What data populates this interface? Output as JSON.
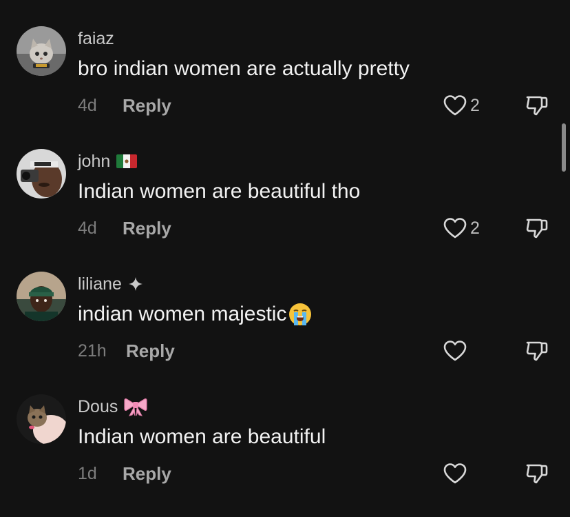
{
  "comments": [
    {
      "username": "faiaz",
      "badge": "",
      "text": "bro indian women are actually pretty",
      "time": "4d",
      "reply_label": "Reply",
      "likes": "2",
      "avatar": "cat-avatar"
    },
    {
      "username": "john",
      "badge": "mexico-flag",
      "text": "Indian women are beautiful tho",
      "time": "4d",
      "reply_label": "Reply",
      "likes": "2",
      "avatar": "man-with-camera-avatar"
    },
    {
      "username": "liliane",
      "badge": "sparkle",
      "text": "indian women majestic",
      "emoji": "loudly-crying-face",
      "time": "21h",
      "reply_label": "Reply",
      "likes": "",
      "avatar": "man-in-beanie-avatar"
    },
    {
      "username": "Dous",
      "badge": "pink-bow",
      "text": "Indian women are beautiful",
      "time": "1d",
      "reply_label": "Reply",
      "likes": "",
      "avatar": "kitten-in-hand-avatar"
    }
  ],
  "colors": {
    "background": "#121212",
    "username": "#c9c9c9",
    "text": "#f2f2f2",
    "timestamp": "#7d7d7d",
    "reply": "#a8a8a8",
    "icon": "#d9d9d9"
  }
}
